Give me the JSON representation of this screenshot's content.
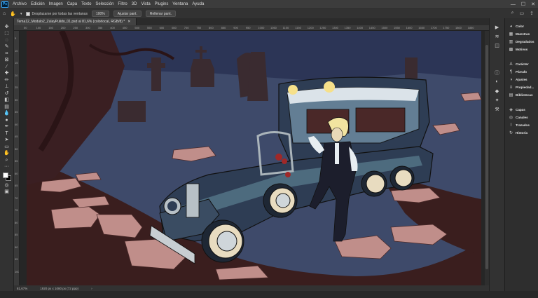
{
  "menubar": {
    "app_logo": "Ps",
    "items": [
      "Archivo",
      "Edición",
      "Imagen",
      "Capa",
      "Texto",
      "Selección",
      "Filtro",
      "3D",
      "Vista",
      "Plugins",
      "Ventana",
      "Ayuda"
    ]
  },
  "options_bar": {
    "scroll_all_label": "Desplazarse por todas las ventanas",
    "zoom_value": "100%",
    "fit_screen_label": "Ajustar pant.",
    "fill_screen_label": "Rellenar pant."
  },
  "document": {
    "tab_title": "Tema12_Modulo2_ZulayPulido_01.psd al 81,6% (colorlocal, RGB/8) *",
    "ruler_top": [
      "50",
      "100",
      "150",
      "200",
      "250",
      "300",
      "350",
      "400",
      "450",
      "500",
      "550",
      "600",
      "650",
      "700",
      "750",
      "800",
      "850",
      "900",
      "950",
      "1000",
      "1050",
      "1100",
      "1150",
      "1200",
      "1250",
      "1300",
      "1350",
      "1400",
      "1450",
      "1500",
      "1550",
      "1600",
      "1650",
      "1700",
      "1750",
      "1800",
      "1850"
    ],
    "ruler_left": [
      "5",
      "10",
      "15",
      "20",
      "25",
      "30",
      "35",
      "40",
      "45",
      "50",
      "55",
      "60",
      "65",
      "70",
      "75",
      "80",
      "85",
      "90",
      "95",
      "100"
    ]
  },
  "status_bar": {
    "zoom": "81,67%",
    "doc_size": "1920 px x 1080 px (72 ppp)"
  },
  "panels": {
    "group1": [
      "Color",
      "Muestras",
      "Degradados",
      "Motivos"
    ],
    "group2": [
      "Carácter",
      "Párrafo",
      "Ajustes",
      "Propiedad...",
      "Bibliotecas"
    ],
    "group3": [
      "Capas",
      "Canales",
      "Trazados",
      "Historia"
    ]
  },
  "colors": {
    "night_sky": "#2c3556",
    "ground": "#3e4a6a",
    "dark_ground": "#3a1e1e",
    "stone": "#c08e8a",
    "hearse_body": "#2e3d54",
    "hearse_accent": "#4d6b7e",
    "tire_wall": "#e8dcc0"
  }
}
